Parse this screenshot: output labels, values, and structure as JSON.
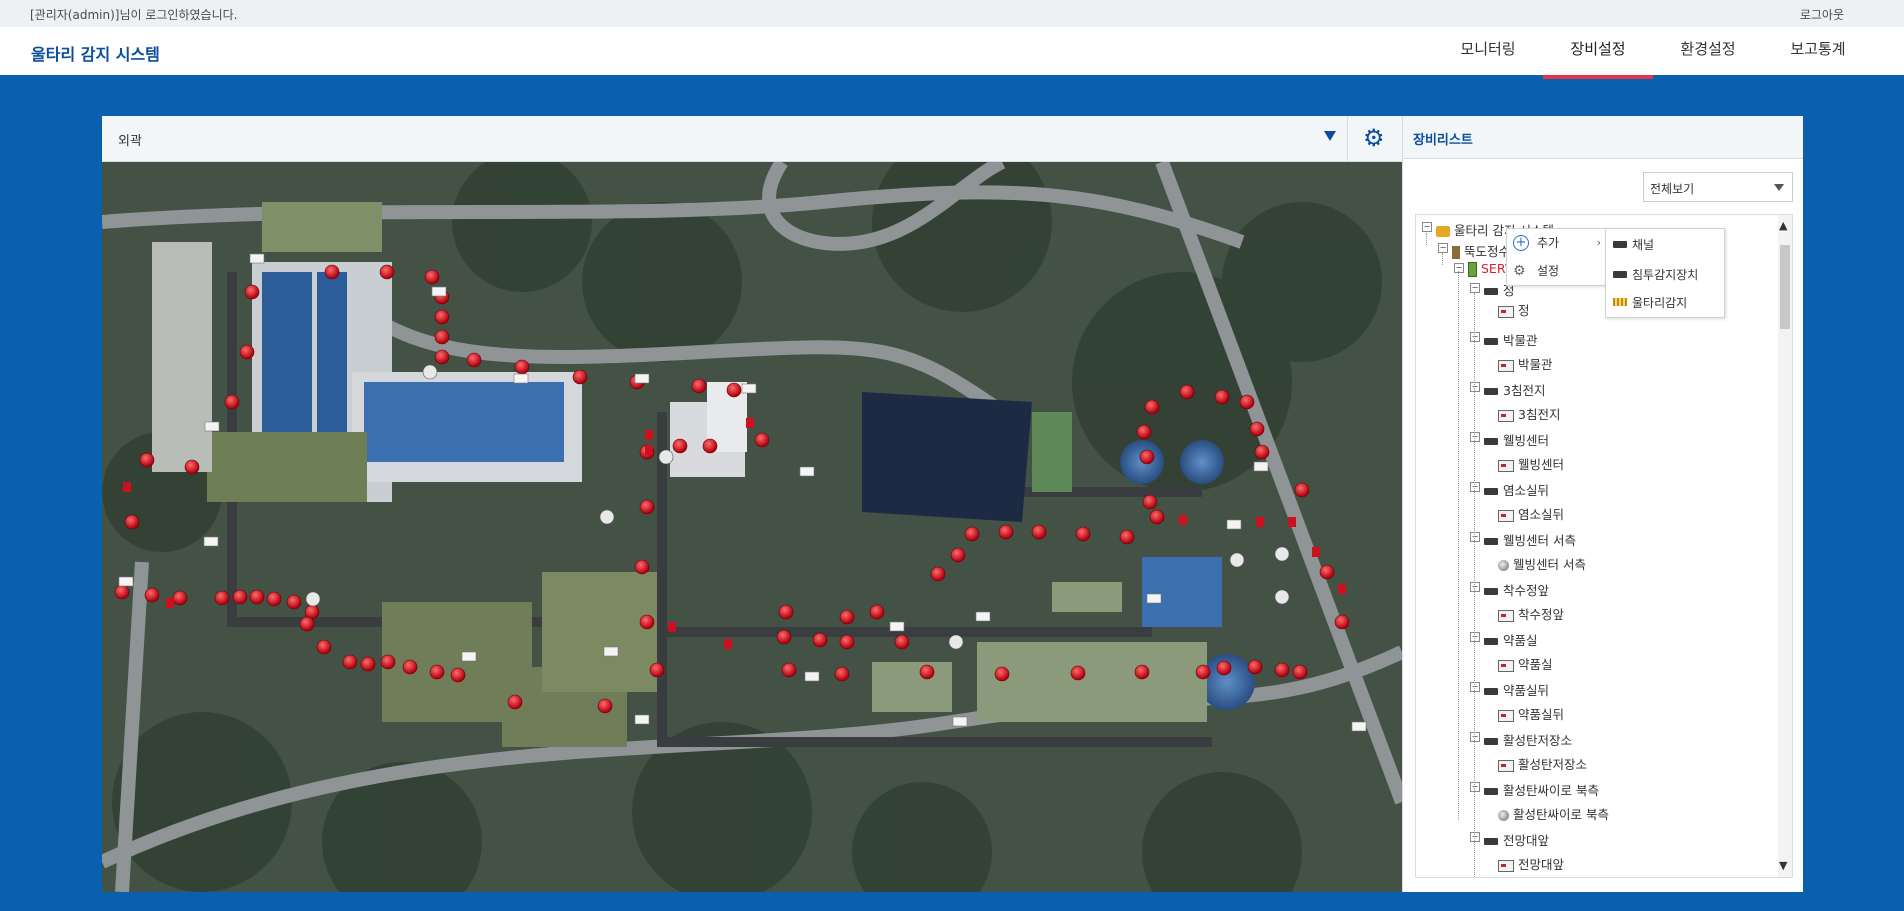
{
  "topbar": {
    "user_text": "[관리자(admin)]님이 로그인하였습니다.",
    "logout_label": "로그아웃"
  },
  "header": {
    "title": "울타리 감지 시스템",
    "nav": [
      {
        "label": "모니터링",
        "active": false
      },
      {
        "label": "장비설정",
        "active": true
      },
      {
        "label": "환경설정",
        "active": false
      },
      {
        "label": "보고통계",
        "active": false
      }
    ]
  },
  "left_panel": {
    "area_label": "외곽"
  },
  "right_panel": {
    "title": "장비리스트",
    "filter_value": "전체보기",
    "tree": {
      "root": "울타리 감지 시스템",
      "site": "뚝도정수장",
      "server": "SERVER",
      "first_group_prefix": "정",
      "groups": [
        {
          "label": "박물관",
          "child": "박물관",
          "child_type": "fence"
        },
        {
          "label": "3침전지",
          "child": "3침전지",
          "child_type": "fence"
        },
        {
          "label": "웰빙센터",
          "child": "웰빙센터",
          "child_type": "fence"
        },
        {
          "label": "염소실뒤",
          "child": "염소실뒤",
          "child_type": "fence"
        },
        {
          "label": "웰빙센터 서측",
          "child": "웰빙센터 서측",
          "child_type": "dome"
        },
        {
          "label": "착수정앞",
          "child": "착수정앞",
          "child_type": "fence"
        },
        {
          "label": "약품실",
          "child": "약품실",
          "child_type": "fence"
        },
        {
          "label": "약품실뒤",
          "child": "약품실뒤",
          "child_type": "fence"
        },
        {
          "label": "활성탄저장소",
          "child": "활성탄저장소",
          "child_type": "fence"
        },
        {
          "label": "활성탄싸이로 북측",
          "child": "활성탄싸이로 북측",
          "child_type": "dome"
        },
        {
          "label": "전망대앞",
          "child": "전망대앞",
          "child_type": "fence"
        }
      ]
    },
    "context_menu": {
      "add_label": "추가",
      "settings_label": "설정"
    },
    "submenu": {
      "items": [
        "채널",
        "침투감지장치",
        "울타리감지"
      ]
    }
  },
  "colors": {
    "brand_blue": "#0a5fae",
    "accent_red": "#e2364a",
    "marker_red": "#d0111b"
  },
  "icons": {
    "settings": "gear-icon",
    "dropdown": "chevron-down-icon"
  }
}
